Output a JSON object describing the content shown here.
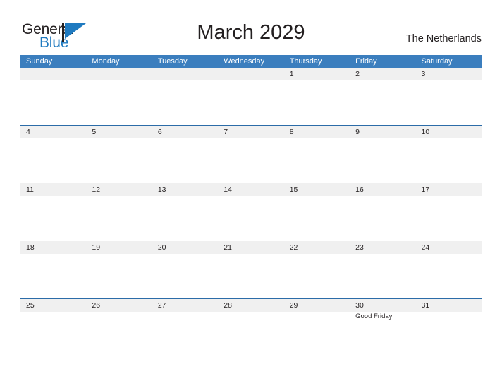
{
  "brand": {
    "name_part1": "General",
    "name_part2": "Blue",
    "flag_icon": "blue-triangle-flag-icon",
    "colors": {
      "dark_text": "#231f20",
      "blue": "#1f7ac0",
      "header_blue": "#3b7ebe",
      "row_line_blue": "#2c6ca8",
      "band_gray": "#f0f0f0"
    }
  },
  "header": {
    "title": "March 2029",
    "region": "The Netherlands"
  },
  "calendar": {
    "weekdays": [
      "Sunday",
      "Monday",
      "Tuesday",
      "Wednesday",
      "Thursday",
      "Friday",
      "Saturday"
    ],
    "weeks": [
      {
        "days": [
          {
            "number": "",
            "event": ""
          },
          {
            "number": "",
            "event": ""
          },
          {
            "number": "",
            "event": ""
          },
          {
            "number": "",
            "event": ""
          },
          {
            "number": "1",
            "event": ""
          },
          {
            "number": "2",
            "event": ""
          },
          {
            "number": "3",
            "event": ""
          }
        ]
      },
      {
        "days": [
          {
            "number": "4",
            "event": ""
          },
          {
            "number": "5",
            "event": ""
          },
          {
            "number": "6",
            "event": ""
          },
          {
            "number": "7",
            "event": ""
          },
          {
            "number": "8",
            "event": ""
          },
          {
            "number": "9",
            "event": ""
          },
          {
            "number": "10",
            "event": ""
          }
        ]
      },
      {
        "days": [
          {
            "number": "11",
            "event": ""
          },
          {
            "number": "12",
            "event": ""
          },
          {
            "number": "13",
            "event": ""
          },
          {
            "number": "14",
            "event": ""
          },
          {
            "number": "15",
            "event": ""
          },
          {
            "number": "16",
            "event": ""
          },
          {
            "number": "17",
            "event": ""
          }
        ]
      },
      {
        "days": [
          {
            "number": "18",
            "event": ""
          },
          {
            "number": "19",
            "event": ""
          },
          {
            "number": "20",
            "event": ""
          },
          {
            "number": "21",
            "event": ""
          },
          {
            "number": "22",
            "event": ""
          },
          {
            "number": "23",
            "event": ""
          },
          {
            "number": "24",
            "event": ""
          }
        ]
      },
      {
        "days": [
          {
            "number": "25",
            "event": ""
          },
          {
            "number": "26",
            "event": ""
          },
          {
            "number": "27",
            "event": ""
          },
          {
            "number": "28",
            "event": ""
          },
          {
            "number": "29",
            "event": ""
          },
          {
            "number": "30",
            "event": "Good Friday"
          },
          {
            "number": "31",
            "event": ""
          }
        ]
      }
    ]
  }
}
